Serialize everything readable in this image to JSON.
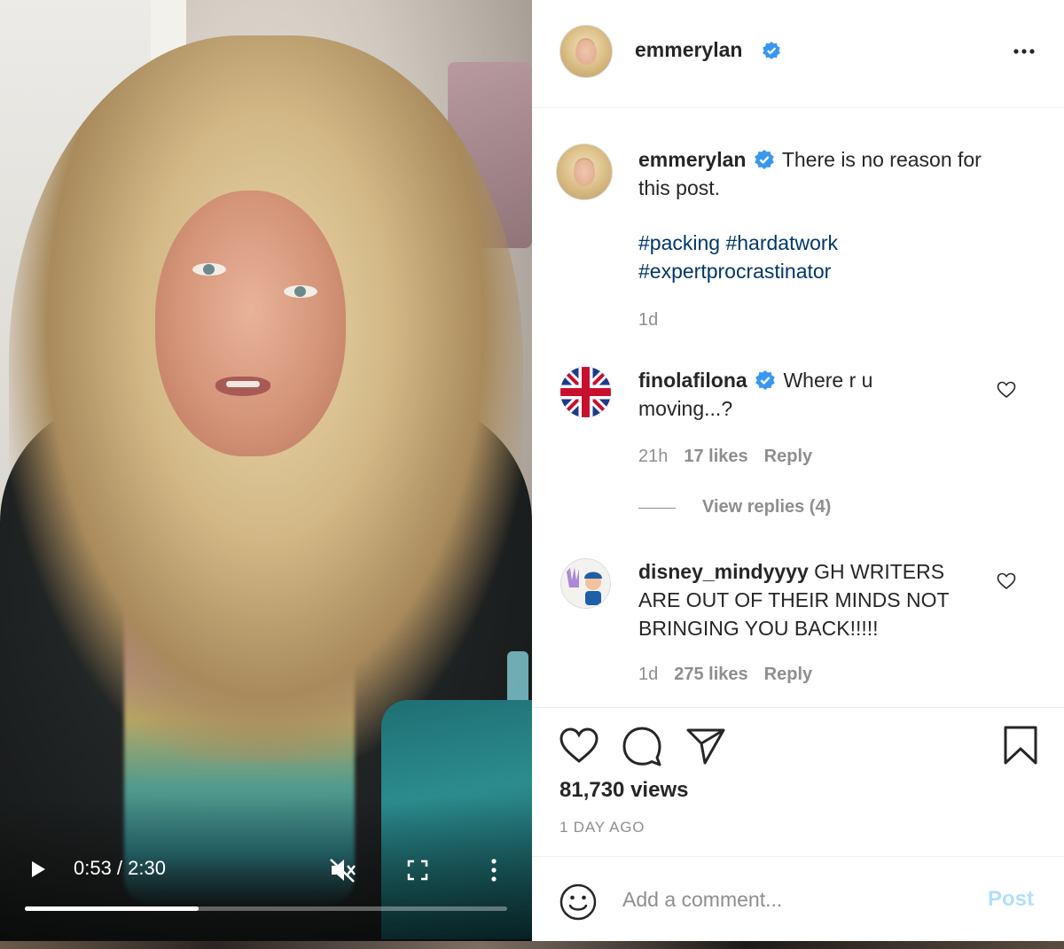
{
  "video": {
    "time_display": "0:53 / 2:30",
    "progress_fraction": 0.36
  },
  "post": {
    "author": "emmerylan",
    "verified": true,
    "caption_line1": "There is no reason for",
    "caption_line2": "this post.",
    "hashtags_line1": [
      "#packing",
      "#hardatwork"
    ],
    "hashtags_line2": [
      "#expertprocrastinator"
    ],
    "caption_age": "1d"
  },
  "comments": [
    {
      "username": "finolafilona",
      "verified": true,
      "text_line1": "Where r u",
      "text_line2": "moving...?",
      "age": "21h",
      "likes": "17 likes",
      "reply": "Reply",
      "view_replies": "View replies (4)"
    },
    {
      "username": "disney_mindyyyy",
      "verified": false,
      "text_line1": "GH WRITERS",
      "text_line2": "ARE OUT OF THEIR MINDS NOT",
      "text_line3": "BRINGING YOU BACK!!!!!",
      "age": "1d",
      "likes": "275 likes",
      "reply": "Reply"
    }
  ],
  "stats": {
    "views": "81,730 views",
    "posted": "1 DAY AGO"
  },
  "composer": {
    "placeholder": "Add a comment...",
    "post_label": "Post"
  },
  "icons": {
    "verified": "verified-badge-icon",
    "like": "heart-icon",
    "comment": "comment-bubble-icon",
    "share": "paper-plane-icon",
    "save": "bookmark-icon",
    "emoji": "emoji-smiley-icon",
    "more": "more-options-icon",
    "play": "play-icon",
    "mute": "muted-speaker-icon",
    "fullscreen": "fullscreen-icon"
  },
  "colors": {
    "verified_blue": "#3897f0",
    "hashtag": "#00376b",
    "secondary_text": "#8e8e8e",
    "post_disabled": "#b2dffc"
  }
}
